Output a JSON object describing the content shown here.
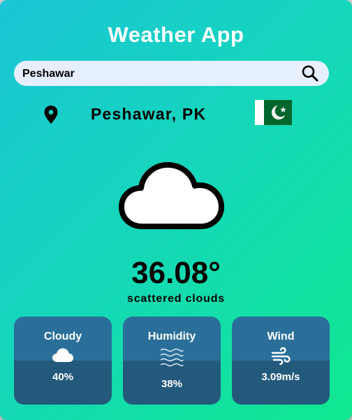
{
  "app": {
    "title": "Weather App"
  },
  "search": {
    "value": "Peshawar",
    "icon": "search-icon"
  },
  "location": {
    "city_label": "Peshawar, PK",
    "pin_icon": "map-pin-icon",
    "flag_icon": "pakistan-flag-icon"
  },
  "current": {
    "icon": "cloud-icon",
    "temperature": "36.08°",
    "description": "scattered clouds"
  },
  "stats": [
    {
      "label": "Cloudy",
      "icon": "cloud-icon",
      "value": "40%"
    },
    {
      "label": "Humidity",
      "icon": "waves-icon",
      "value": "38%"
    },
    {
      "label": "Wind",
      "icon": "wind-icon",
      "value": "3.09m/s"
    }
  ],
  "colors": {
    "gradient_start": "#1bc5d6",
    "gradient_end": "#10e88f",
    "card_top": "#2a6f9a",
    "card_bottom": "#235a7c",
    "search_bg": "#e6efff",
    "flag_green": "#01662c"
  }
}
